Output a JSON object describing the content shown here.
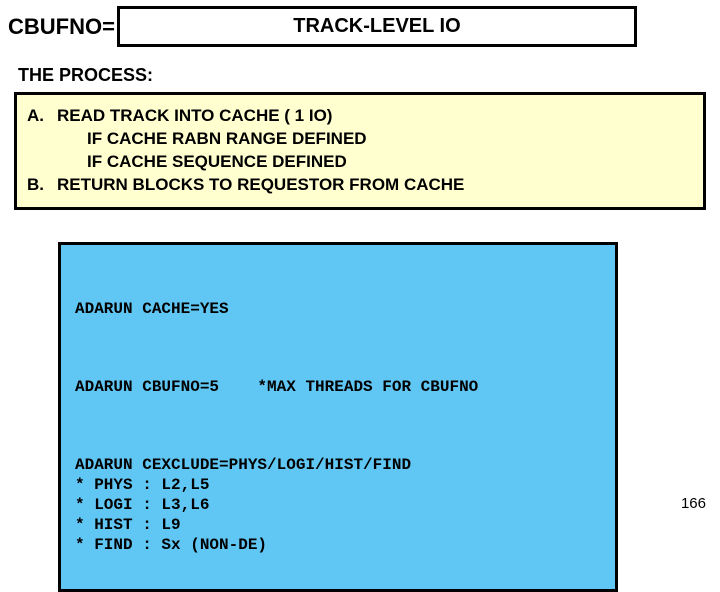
{
  "header": {
    "left_label": "CBUFNO=",
    "title": "TRACK-LEVEL IO"
  },
  "process": {
    "heading": "THE PROCESS:",
    "lines": [
      {
        "marker": "A.",
        "text": "READ TRACK INTO CACHE ( 1 IO)"
      },
      {
        "marker": "",
        "text": "IF CACHE RABN RANGE DEFINED"
      },
      {
        "marker": "",
        "text": "IF CACHE SEQUENCE DEFINED"
      },
      {
        "marker": "B.",
        "text": "RETURN BLOCKS TO REQUESTOR FROM CACHE"
      }
    ]
  },
  "code": {
    "block1": "ADARUN CACHE=YES",
    "block2": "ADARUN CBUFNO=5    *MAX THREADS FOR CBUFNO",
    "block3": "ADARUN CEXCLUDE=PHYS/LOGI/HIST/FIND\n* PHYS : L2,L5\n* LOGI : L3,L6\n* HIST : L9\n* FIND : Sx (NON-DE)"
  },
  "page_number": "166"
}
